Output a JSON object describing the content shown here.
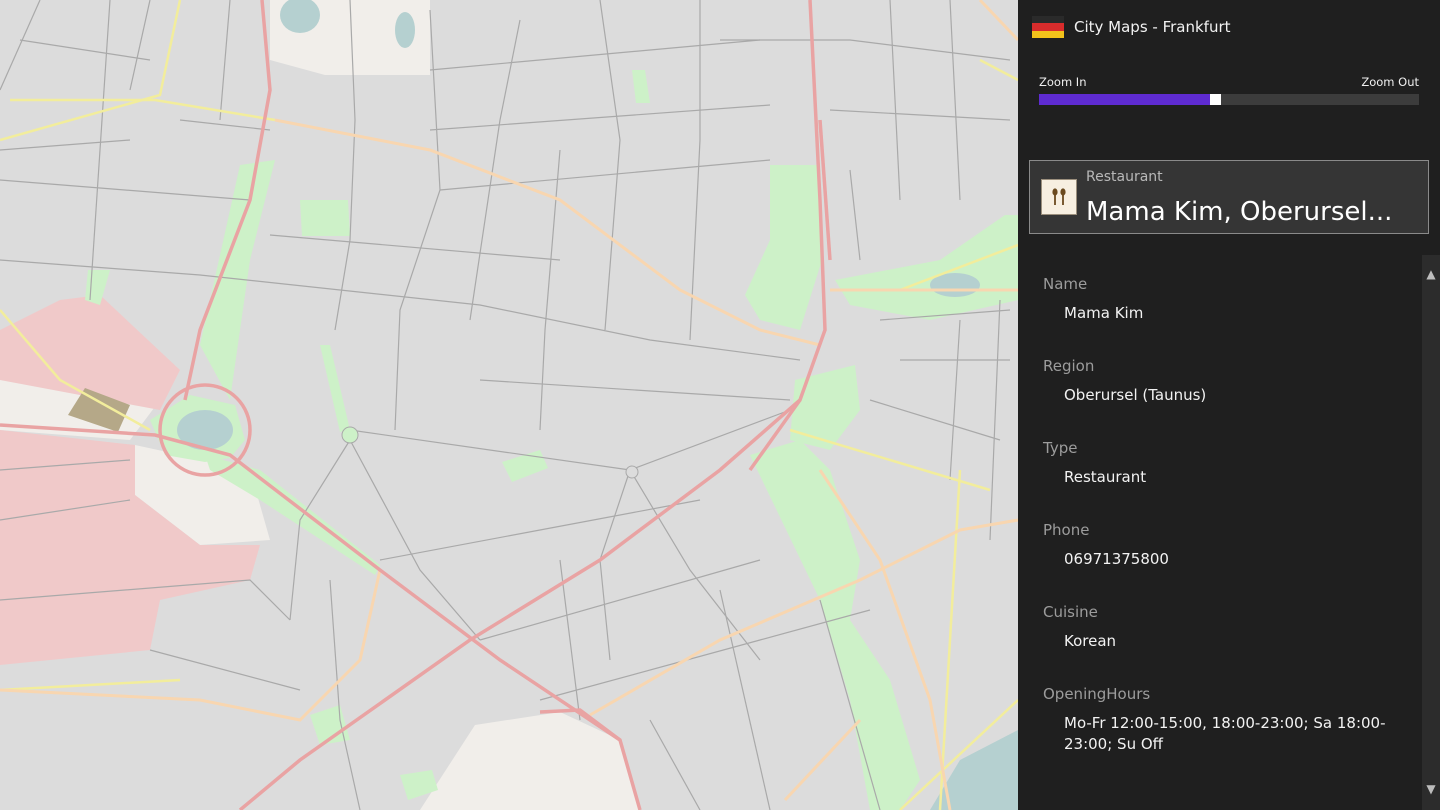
{
  "app": {
    "title": "City Maps - Frankfurt",
    "flag_colors": [
      "#2a2a2a",
      "#d92c2c",
      "#f2c21b"
    ]
  },
  "zoom": {
    "in_label": "Zoom In",
    "out_label": "Zoom Out",
    "level": 0.45,
    "fill_color": "#5e2bd1"
  },
  "place": {
    "type": "Restaurant",
    "title": "Mama Kim, Oberursel...",
    "icon": "restaurant-icon"
  },
  "details": [
    {
      "label": "Name",
      "value": "Mama Kim"
    },
    {
      "label": "Region",
      "value": "Oberursel (Taunus)"
    },
    {
      "label": "Type",
      "value": "Restaurant"
    },
    {
      "label": "Phone",
      "value": "06971375800"
    },
    {
      "label": "Cuisine",
      "value": "Korean"
    },
    {
      "label": "OpeningHours",
      "value": "Mo-Fr 12:00-15:00, 18:00-23:00; Sa 18:00-23:00; Su Off"
    }
  ],
  "map_colors": {
    "land": "#dcdcdc",
    "park": "#cdf1c8",
    "industrial": "#f0c9c9",
    "water": "#b5d0d0",
    "major_road": "#e9a3a3",
    "secondary_road": "#f8d6b0",
    "minor_road": "#f6f2a6"
  }
}
